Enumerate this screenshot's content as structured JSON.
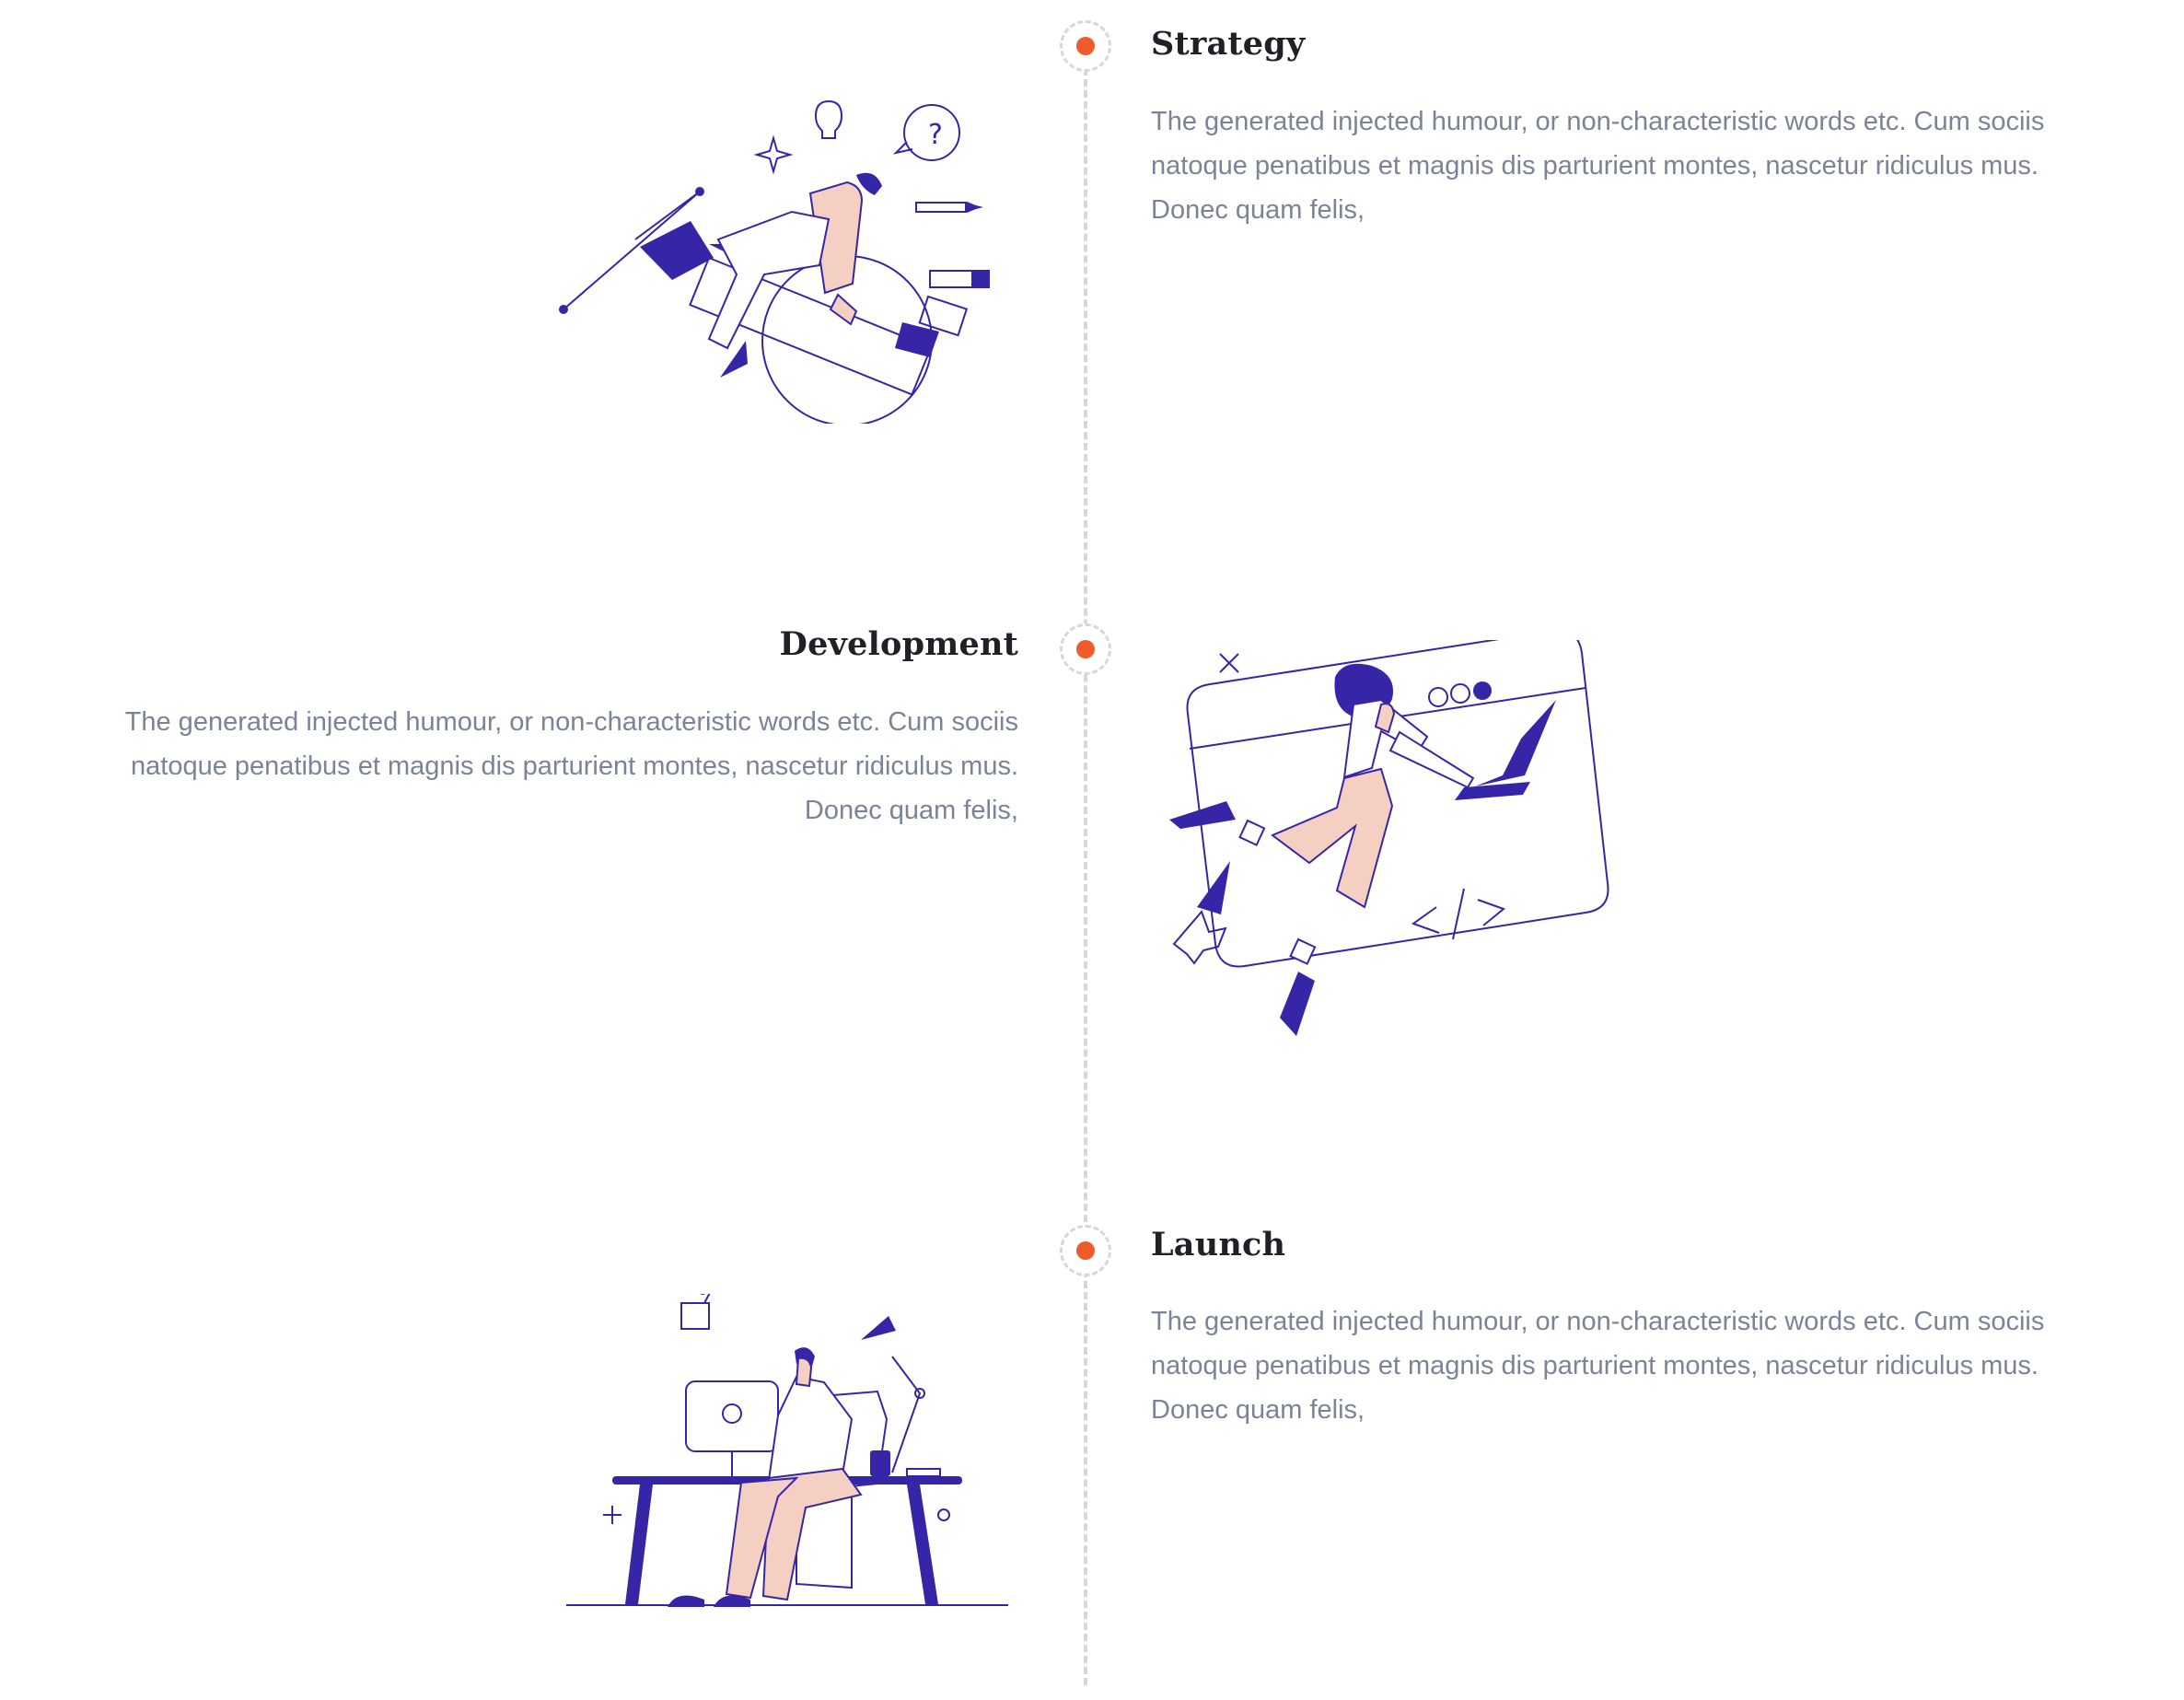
{
  "timeline": {
    "steps": [
      {
        "title": "Strategy",
        "description": "The generated injected humour, or non-characteristic words etc. Cum sociis natoque penatibus et magnis dis parturient montes, nascetur ridiculus mus. Donec quam felis,",
        "illustration_icon": "pen-rocket-illustration"
      },
      {
        "title": "Development",
        "description": "The generated injected humour, or non-characteristic words etc. Cum sociis natoque penatibus et magnis dis parturient montes, nascetur ridiculus mus. Donec quam felis,",
        "illustration_icon": "laptop-flying-illustration"
      },
      {
        "title": "Launch",
        "description": "The generated injected humour, or non-characteristic words etc. Cum sociis natoque penatibus et magnis dis parturient montes, nascetur ridiculus mus. Donec quam felis,",
        "illustration_icon": "desk-workstation-illustration"
      }
    ]
  },
  "colors": {
    "accent_dot": "#ef5b2b",
    "illustration_primary": "#3626a7",
    "illustration_skin": "#f6cfc3",
    "heading": "#1f2126",
    "body_text": "#7b8496",
    "timeline_line": "#d4d7de"
  }
}
